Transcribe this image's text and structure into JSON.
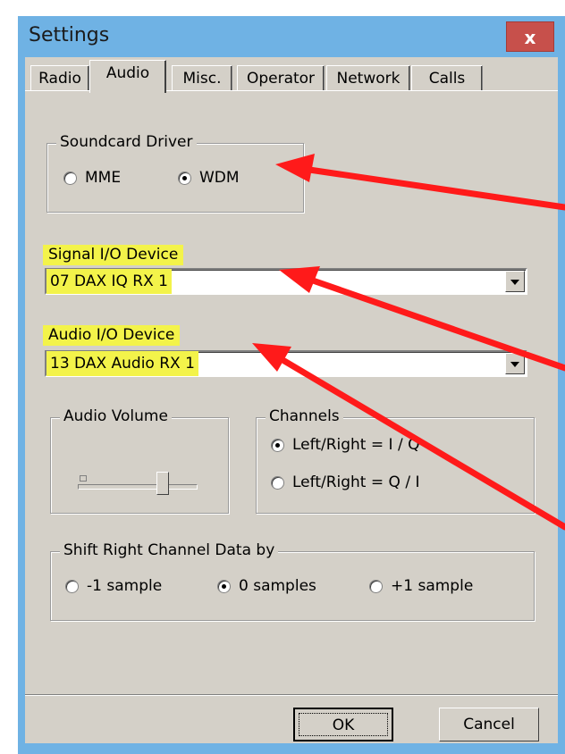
{
  "window": {
    "title": "Settings",
    "close_label": "x"
  },
  "tabs": [
    {
      "label": "Radio",
      "active": false
    },
    {
      "label": "Audio",
      "active": true
    },
    {
      "label": "Misc.",
      "active": false
    },
    {
      "label": "Operator",
      "active": false
    },
    {
      "label": "Network",
      "active": false
    },
    {
      "label": "Calls",
      "active": false
    }
  ],
  "soundcard_driver": {
    "label": "Soundcard Driver",
    "options": [
      {
        "label": "MME",
        "checked": false
      },
      {
        "label": "WDM",
        "checked": true
      }
    ]
  },
  "signal_io": {
    "label": "Signal I/O Device",
    "value": "07  DAX IQ RX 1"
  },
  "audio_io": {
    "label": "Audio I/O Device",
    "value": "13  DAX Audio RX 1"
  },
  "audio_volume": {
    "label": "Audio Volume"
  },
  "channels": {
    "label": "Channels",
    "options": [
      {
        "label": "Left/Right = I / Q",
        "checked": true
      },
      {
        "label": "Left/Right = Q / I",
        "checked": false
      }
    ]
  },
  "shift": {
    "label": "Shift Right Channel Data by",
    "options": [
      {
        "label": "-1 sample",
        "checked": false
      },
      {
        "label": "0 samples",
        "checked": true
      },
      {
        "label": "+1 sample",
        "checked": false
      }
    ]
  },
  "buttons": {
    "ok_label": "OK",
    "cancel_label": "Cancel"
  },
  "colors": {
    "window_frame": "#6fb2e4",
    "close_button": "#c7504b",
    "highlight": "#f3f34a",
    "annotation_arrow": "#ff1a1a"
  }
}
